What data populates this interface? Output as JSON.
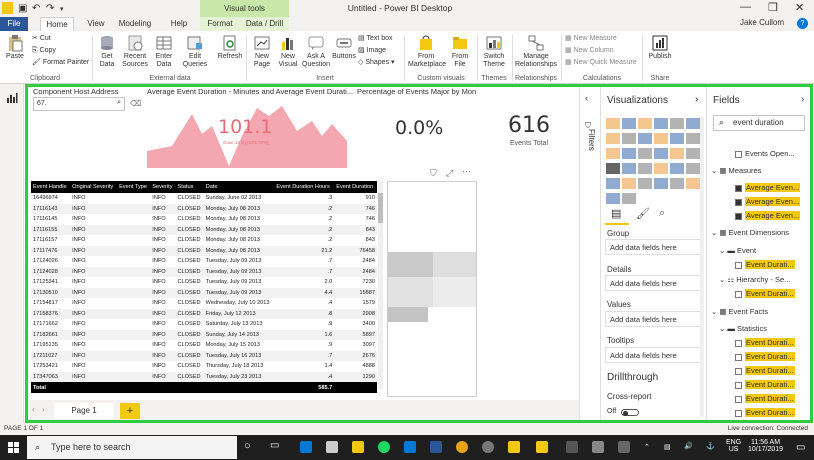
{
  "titlebar": {
    "context_tab": "Visual tools",
    "title": "Untitled - Power BI Desktop",
    "minimize": "—",
    "restore": "❐",
    "close": "✕"
  },
  "tabs": {
    "file": "File",
    "items": [
      "Home",
      "View",
      "Modeling",
      "Help",
      "Format",
      "Data / Drill"
    ],
    "user": "Jake Cullom",
    "help_icon": "?"
  },
  "ribbon": {
    "clipboard": {
      "paste": "Paste",
      "cut": "Cut",
      "copy": "Copy",
      "format_painter": "Format Painter",
      "group": "Clipboard"
    },
    "external_data": {
      "get_data": "Get Data",
      "recent_sources": "Recent Sources",
      "enter_data": "Enter Data",
      "edit_queries": "Edit Queries",
      "refresh": "Refresh",
      "group": "External data"
    },
    "insert": {
      "new_page": "New Page",
      "new_visual": "New Visual",
      "ask_question": "Ask A Question",
      "buttons": "Buttons",
      "text_box": "Text box",
      "image": "Image",
      "shapes": "Shapes",
      "group": "Insert"
    },
    "custom_visuals": {
      "from_marketplace": "From Marketplace",
      "from_file": "From File",
      "group": "Custom visuals"
    },
    "themes": {
      "switch_theme": "Switch Theme",
      "group": "Themes"
    },
    "relationships": {
      "manage": "Manage Relationships",
      "group": "Relationships"
    },
    "calculations": {
      "new_measure": "New Measure",
      "new_column": "New Column",
      "new_quick_measure": "New Quick Measure",
      "group": "Calculations"
    },
    "share": {
      "publish": "Publish",
      "group": "Share"
    }
  },
  "canvas": {
    "slicer_title": "Component Host Address",
    "slicer_value": "67.",
    "gauge_title": "Average Event Duration - Minutes and Average Event Durati...",
    "gauge_value": "101.1",
    "gauge_goal": "Goal: 15.8 (+573.72%)",
    "pct_title": "Percentage of Events Major by Mon...",
    "pct_value": "0.0%",
    "total_value": "616",
    "total_label": "Events Total"
  },
  "table": {
    "columns": [
      "Event Handle",
      "Original Severity",
      "Event Type",
      "Severity",
      "Status",
      "Date",
      "Event Duration Hours",
      "Event Duration"
    ],
    "rows": [
      [
        "16496974",
        "INFO",
        "",
        "INFO",
        "CLOSED",
        "Sunday, June 02 2013",
        ".3",
        "910"
      ],
      [
        "17116143",
        "INFO",
        "",
        "INFO",
        "CLOSED",
        "Monday, July 08 2013",
        ".2",
        "746"
      ],
      [
        "17116145",
        "INFO",
        "",
        "INFO",
        "CLOSED",
        "Monday, July 08 2013",
        ".2",
        "746"
      ],
      [
        "17116155",
        "INFO",
        "",
        "INFO",
        "CLOSED",
        "Monday, July 08 2013",
        ".2",
        "843"
      ],
      [
        "17116157",
        "INFO",
        "",
        "INFO",
        "CLOSED",
        "Monday, July 08 2013",
        ".2",
        "843"
      ],
      [
        "17117476",
        "INFO",
        "",
        "INFO",
        "CLOSED",
        "Monday, July 08 2013",
        "21.2",
        "76458"
      ],
      [
        "17124026",
        "INFO",
        "",
        "INFO",
        "CLOSED",
        "Tuesday, July 09 2013",
        ".7",
        "2484"
      ],
      [
        "17124028",
        "INFO",
        "",
        "INFO",
        "CLOSED",
        "Tuesday, July 09 2013",
        ".7",
        "2484"
      ],
      [
        "17125341",
        "INFO",
        "",
        "INFO",
        "CLOSED",
        "Tuesday, July 09 2013",
        "2.0",
        "7230"
      ],
      [
        "17130510",
        "INFO",
        "",
        "INFO",
        "CLOSED",
        "Tuesday, July 09 2013",
        "4.4",
        "15887"
      ],
      [
        "17154817",
        "INFO",
        "",
        "INFO",
        "CLOSED",
        "Wednesday, July 10 2013",
        ".4",
        "1579"
      ],
      [
        "17158376",
        "INFO",
        "",
        "INFO",
        "CLOSED",
        "Friday, July 12 2013",
        ".8",
        "2908"
      ],
      [
        "17171662",
        "INFO",
        "",
        "INFO",
        "CLOSED",
        "Saturday, July 13 2013",
        ".9",
        "3400"
      ],
      [
        "17182661",
        "INFO",
        "",
        "INFO",
        "CLOSED",
        "Sunday, July 14 2013",
        "1.6",
        "5897"
      ],
      [
        "17195135",
        "INFO",
        "",
        "INFO",
        "CLOSED",
        "Monday, July 15 2013",
        ".9",
        "3097"
      ],
      [
        "17211027",
        "INFO",
        "",
        "INFO",
        "CLOSED",
        "Tuesday, July 16 2013",
        ".7",
        "2676"
      ],
      [
        "17253421",
        "INFO",
        "",
        "INFO",
        "CLOSED",
        "Thursday, July 18 2013",
        "1.4",
        "4888"
      ],
      [
        "17347063",
        "INFO",
        "",
        "INFO",
        "CLOSED",
        "Tuesday, July 23 2013",
        ".4",
        "1290"
      ]
    ],
    "total_label": "Total",
    "total_hours": "585.7"
  },
  "pages": {
    "page1": "Page 1",
    "add": "+"
  },
  "filters": {
    "label": "Filters"
  },
  "visualizations": {
    "title": "Visualizations",
    "wells": [
      {
        "label": "Group",
        "placeholder": "Add data fields here"
      },
      {
        "label": "Details",
        "placeholder": "Add data fields here"
      },
      {
        "label": "Values",
        "placeholder": "Add data fields here"
      },
      {
        "label": "Tooltips",
        "placeholder": "Add data fields here"
      }
    ],
    "drillthrough": "Drillthrough",
    "cross_report": "Cross-report",
    "toggle_off": "Off"
  },
  "fields": {
    "title": "Fields",
    "search_value": "event duration",
    "events_open": "Events Open...",
    "measures": "Measures",
    "measure_items": [
      "Average Even...",
      "Average Even...",
      "Average Even..."
    ],
    "event_dimensions": "Event Dimensions",
    "event": "Event",
    "event_duration": "Event Durati...",
    "hierarchy": "Hierarchy - Se...",
    "hierarchy_item": "Event Durati...",
    "event_facts": "Event Facts",
    "statistics": "Statistics",
    "stat_items": [
      "Event Durati...",
      "Event Durati...",
      "Event Durati...",
      "Event Durati...",
      "Event Durati...",
      "Event Durati..."
    ]
  },
  "status": {
    "page": "PAGE 1 OF 1",
    "connection": "Live connection: Connected"
  },
  "taskbar": {
    "search": "Type here to search",
    "lang": "ENG",
    "region": "US",
    "time": "11:56 AM",
    "date": "10/17/2019"
  },
  "colors": {
    "accent_green": "#2ecc40",
    "highlight": "#f2c811",
    "file_tab": "#2b579a",
    "gauge_fill": "#f4a7b0"
  }
}
